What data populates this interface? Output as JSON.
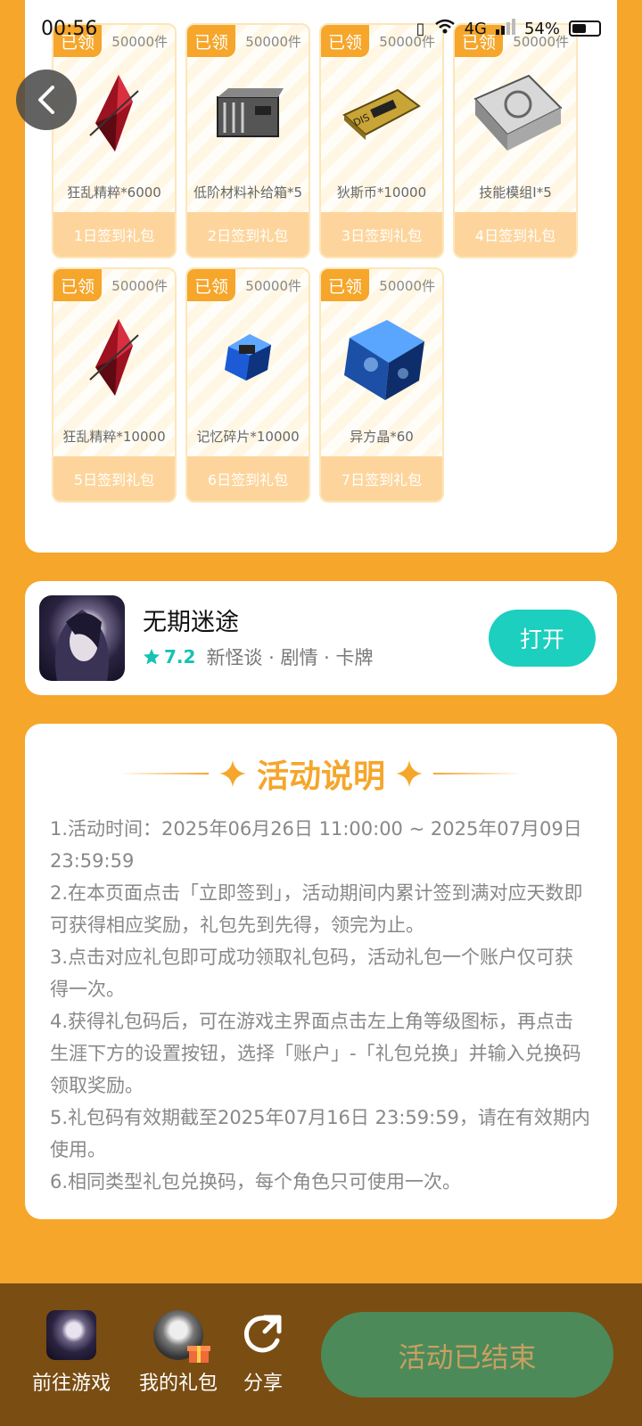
{
  "status_bar": {
    "time": "00:56",
    "network": "4G",
    "battery": "54%",
    "battery_level": 0.54
  },
  "colors": {
    "primary": "#f5a62b",
    "teal": "#1ccfbf",
    "ended_bg": "#4c8a5a",
    "bottom_bar": "#7a4d13"
  },
  "gifts": [
    {
      "badge": "已领",
      "qty": "50000件",
      "name": "狂乱精粹*6000",
      "button": "1日签到礼包",
      "icon": "red-crystal-icon"
    },
    {
      "badge": "已领",
      "qty": "50000件",
      "name": "低阶材料补给箱*5",
      "button": "2日签到礼包",
      "icon": "supply-crate-icon"
    },
    {
      "badge": "已领",
      "qty": "50000件",
      "name": "狄斯币*10000",
      "button": "3日签到礼包",
      "icon": "dis-coin-icon"
    },
    {
      "badge": "已领",
      "qty": "50000件",
      "name": "技能模组I*5",
      "button": "4日签到礼包",
      "icon": "skill-module-icon"
    },
    {
      "badge": "已领",
      "qty": "50000件",
      "name": "狂乱精粹*10000",
      "button": "5日签到礼包",
      "icon": "red-crystal-icon"
    },
    {
      "badge": "已领",
      "qty": "50000件",
      "name": "记忆碎片*10000",
      "button": "6日签到礼包",
      "icon": "memory-shard-icon"
    },
    {
      "badge": "已领",
      "qty": "50000件",
      "name": "异方晶*60",
      "button": "7日签到礼包",
      "icon": "blue-cube-icon"
    }
  ],
  "app": {
    "name": "无期迷途",
    "rating": "7.2",
    "tags": "新怪谈 · 剧情 · 卡牌",
    "open_button": "打开"
  },
  "rules": {
    "title": "活动说明",
    "items": [
      "1.活动时间：2025年06月26日 11:00:00 ~ 2025年07月09日 23:59:59",
      "2.在本页面点击「立即签到」，活动期间内累计签到满对应天数即可获得相应奖励，礼包先到先得，领完为止。",
      "3.点击对应礼包即可成功领取礼包码，活动礼包一个账户仅可获得一次。",
      "4.获得礼包码后，可在游戏主界面点击左上角等级图标，再点击生涯下方的设置按钮，选择「账户」-「礼包兑换」并输入兑换码领取奖励。",
      "5.礼包码有效期截至2025年07月16日 23:59:59，请在有效期内使用。",
      "6.相同类型礼包兑换码，每个角色只可使用一次。"
    ]
  },
  "bottom": {
    "goto_game": "前往游戏",
    "my_gifts": "我的礼包",
    "share": "分享",
    "ended": "活动已结束"
  }
}
